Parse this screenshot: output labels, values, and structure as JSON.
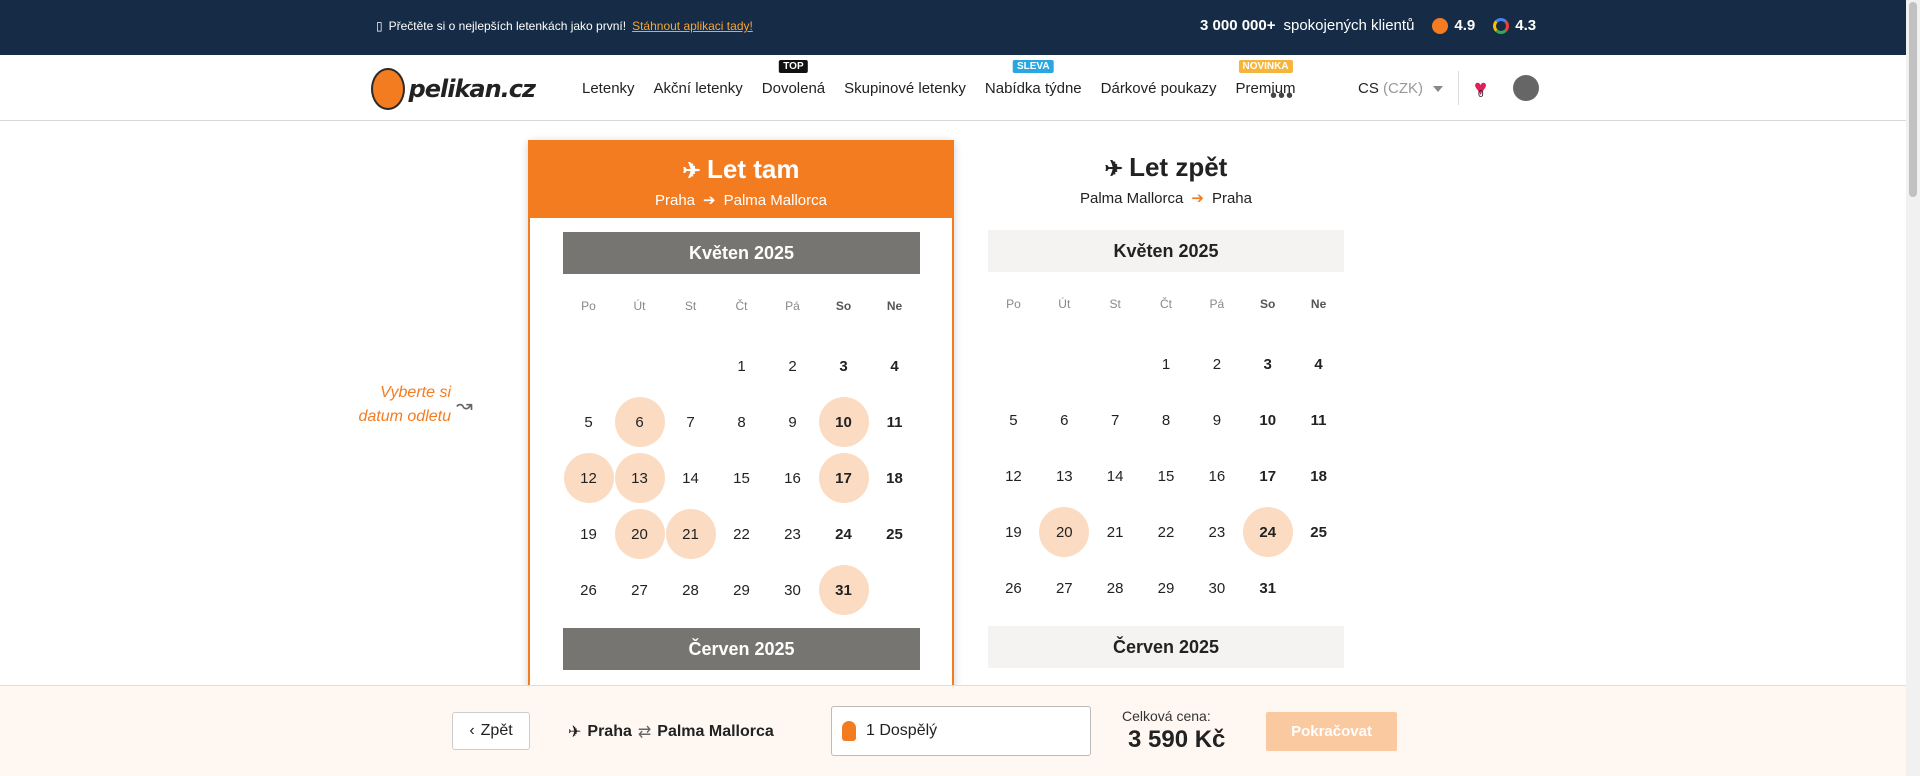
{
  "topbar": {
    "promo_text": "Přečtěte si o nejlepších letenkách jako první!",
    "promo_link": "Stáhnout aplikaci tady!",
    "clients_count": "3 000 000+",
    "clients_text": "spokojených klientů",
    "rating_pelikan": "4.9",
    "rating_google": "4.3"
  },
  "nav": {
    "logo": "pelikan.cz",
    "items": [
      {
        "label": "Letenky",
        "badge": ""
      },
      {
        "label": "Akční letenky",
        "badge": ""
      },
      {
        "label": "Dovolená",
        "badge": "TOP"
      },
      {
        "label": "Skupinové letenky",
        "badge": ""
      },
      {
        "label": "Nabídka týdne",
        "badge": "SLEVA"
      },
      {
        "label": "Dárkové poukazy",
        "badge": ""
      },
      {
        "label": "Premium",
        "badge": "NOVINKA"
      }
    ],
    "more": "•••",
    "lang": "CS",
    "currency": "(CZK)",
    "favorites_count": "0"
  },
  "hint": {
    "line1": "Vyberte si",
    "line2": "datum odletu"
  },
  "outbound": {
    "title": "Let tam",
    "from": "Praha",
    "to": "Palma Mallorca",
    "month1": "Květen  2025",
    "month2": "Červen  2025",
    "highlighted_days": [
      6,
      10,
      12,
      13,
      17,
      20,
      21,
      31
    ]
  },
  "return": {
    "title": "Let zpět",
    "from": "Palma Mallorca",
    "to": "Praha",
    "month1": "Květen  2025",
    "month2": "Červen  2025",
    "highlighted_days": [
      20,
      24
    ]
  },
  "weekdays": [
    "Po",
    "Út",
    "St",
    "Čt",
    "Pá",
    "So",
    "Ne"
  ],
  "footer": {
    "back": "Zpět",
    "from": "Praha",
    "to": "Palma Mallorca",
    "passengers": "1 Dospělý",
    "price_label": "Celková cena:",
    "price": "3 590 Kč",
    "continue": "Pokračovat"
  },
  "colors": {
    "accent": "#f47c20",
    "highlight": "#fbdcc2",
    "topbar": "#162b45"
  }
}
